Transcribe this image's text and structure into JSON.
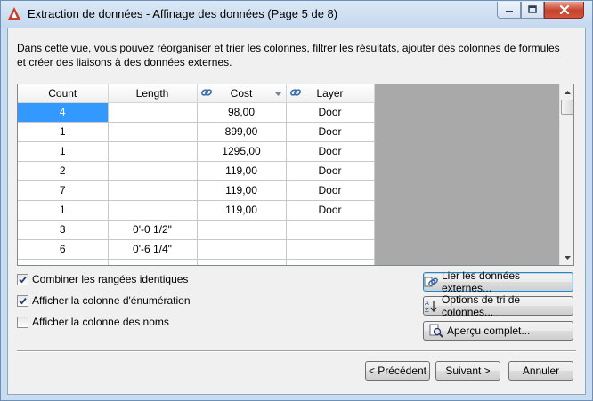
{
  "window": {
    "title": "Extraction de données - Affinage des données (Page 5 de 8)",
    "accent": "#c7412c"
  },
  "description": "Dans cette vue, vous pouvez réorganiser et trier les colonnes, filtrer les résultats, ajouter des colonnes de formules et créer des liaisons à des données externes.",
  "grid": {
    "columns": [
      "Count",
      "Length",
      "Cost",
      "Layer"
    ],
    "rows": [
      [
        "4",
        "",
        "98,00",
        "Door"
      ],
      [
        "1",
        "",
        "899,00",
        "Door"
      ],
      [
        "1",
        "",
        "1295,00",
        "Door"
      ],
      [
        "2",
        "",
        "119,00",
        "Door"
      ],
      [
        "7",
        "",
        "119,00",
        "Door"
      ],
      [
        "1",
        "",
        "119,00",
        "Door"
      ],
      [
        "3",
        "0'-0 1/2\"",
        "",
        ""
      ],
      [
        "6",
        "0'-6 1/4\"",
        "",
        ""
      ],
      [
        "",
        "",
        "",
        ""
      ]
    ]
  },
  "options": {
    "combine": {
      "label": "Combiner les rangées identiques",
      "checked": true
    },
    "enumeration": {
      "label": "Afficher la colonne d'énumération",
      "checked": true
    },
    "names": {
      "label": "Afficher la colonne des noms",
      "checked": false
    }
  },
  "actions": {
    "link_external": "Lier les données externes...",
    "sort_options": "Options de tri de colonnes...",
    "preview": "Aperçu complet..."
  },
  "footer": {
    "back": "< Précédent",
    "next": "Suivant >",
    "cancel": "Annuler"
  }
}
